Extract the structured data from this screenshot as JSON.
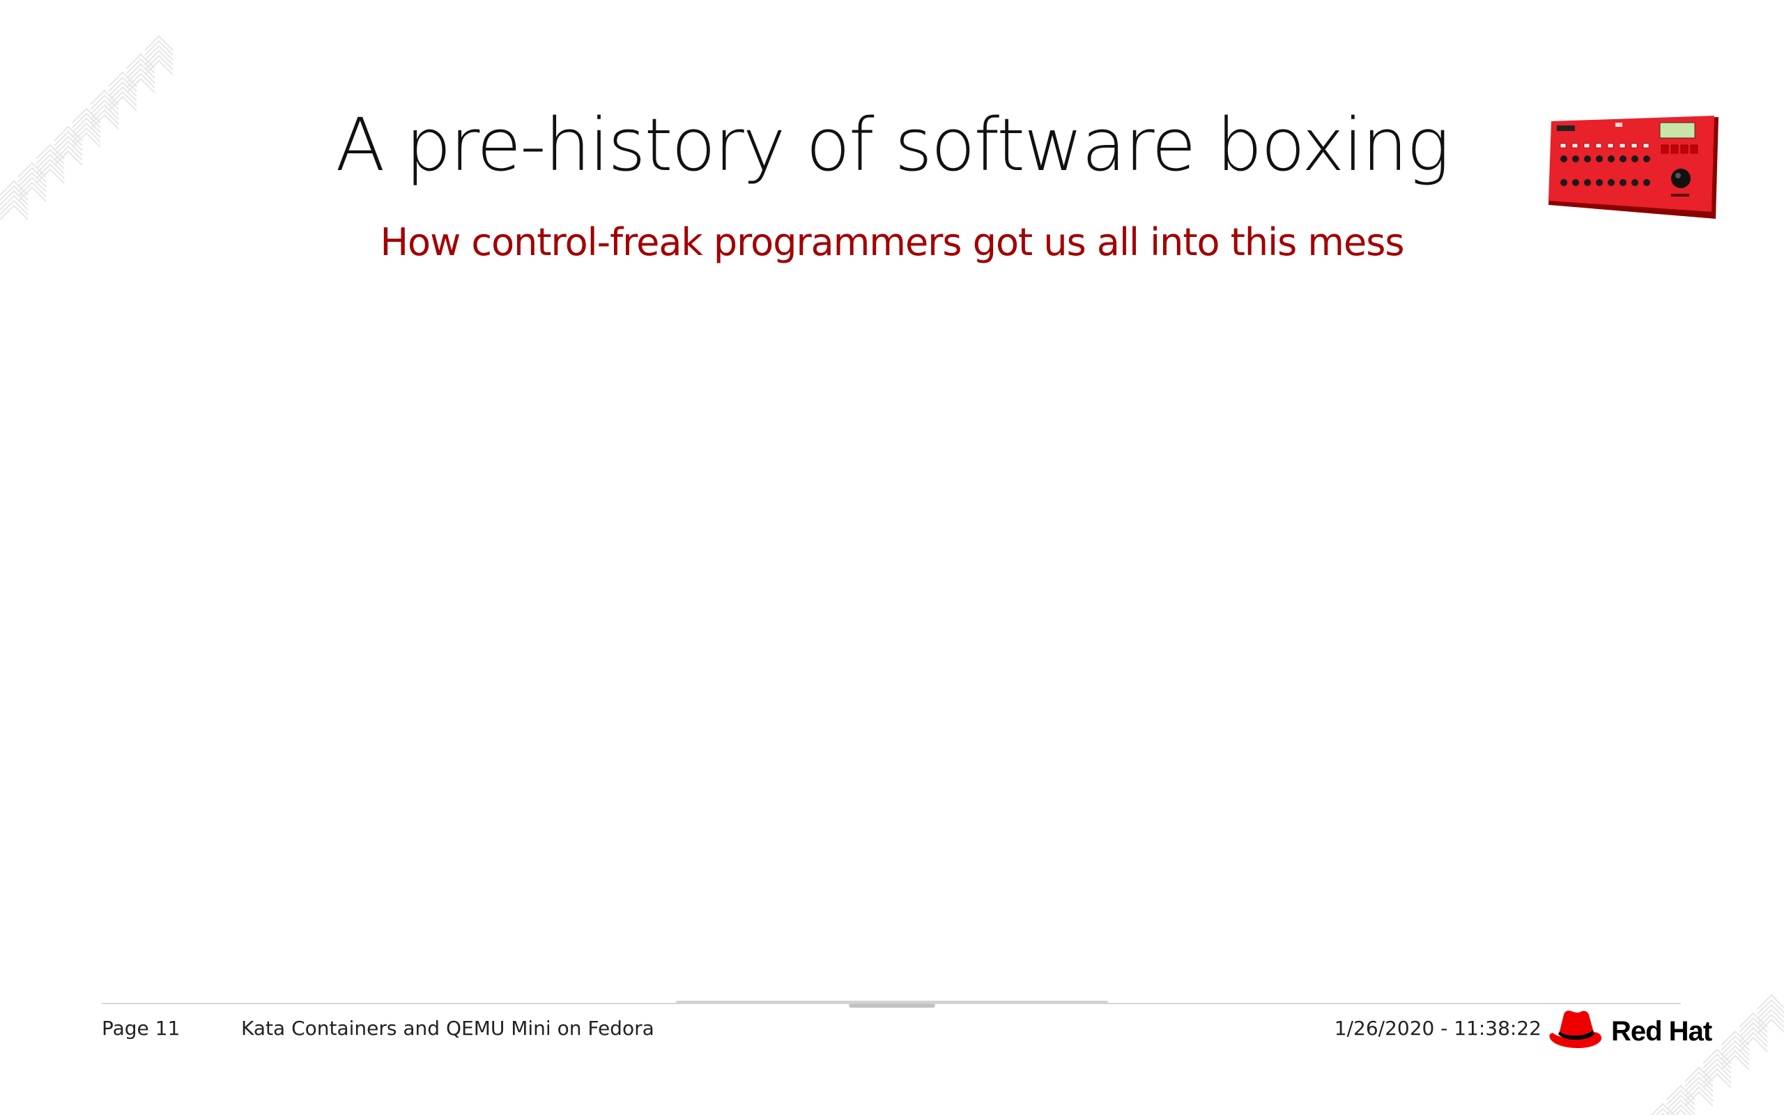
{
  "slide": {
    "title": "A pre-history of software boxing",
    "subtitle": "How control-freak programmers got us all into this mess"
  },
  "footer": {
    "page_label": "Page 11",
    "deck_title": "Kata Containers and QEMU Mini on Fedora",
    "timestamp": "1/26/2020 - 11:38:22",
    "logo_text": "Red Hat"
  },
  "icons": {
    "logo": "red-hat-fedora-icon",
    "image": "red-synthesizer-device-image",
    "decoration": "chevron-pattern-decoration"
  },
  "colors": {
    "title": "#111111",
    "subtitle": "#a30000",
    "brand_red": "#ee0000",
    "rule": "#d8d8d8"
  }
}
